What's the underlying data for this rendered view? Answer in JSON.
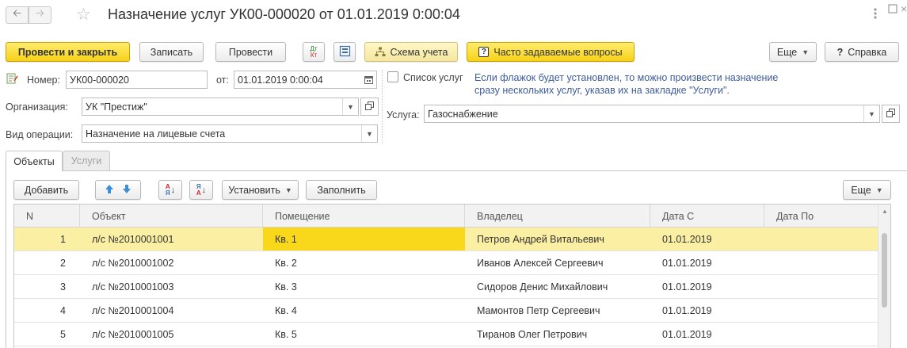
{
  "title": "Назначение услуг УК00-000020 от 01.01.2019 0:00:04",
  "toolbar": {
    "post_close": "Провести и закрыть",
    "save": "Записать",
    "post": "Провести",
    "dtkt_icon_text": "Дт Кт",
    "scheme": "Схема учета",
    "faq": "Часто задаваемые вопросы",
    "more": "Еще",
    "help": "Справка"
  },
  "form": {
    "number_label": "Номер:",
    "number_value": "УК00-000020",
    "from_label": "от:",
    "date_value": "01.01.2019  0:00:04",
    "org_label": "Организация:",
    "org_value": "УК \"Престиж\"",
    "op_label": "Вид операции:",
    "op_value": "Назначение на лицевые счета",
    "services_list_label": "Список услуг",
    "hint_line1": "Если флажок будет установлен, то можно произвести назначение",
    "hint_line2": "сразу нескольких услуг, указав их на закладке \"Услуги\".",
    "service_label": "Услуга:",
    "service_value": "Газоснабжение"
  },
  "tabs": [
    "Объекты",
    "Услуги"
  ],
  "table_toolbar": {
    "add": "Добавить",
    "set": "Установить",
    "fill": "Заполнить",
    "more": "Еще"
  },
  "table": {
    "columns": [
      "N",
      "Объект",
      "Помещение",
      "Владелец",
      "Дата С",
      "Дата По"
    ],
    "rows": [
      {
        "n": "1",
        "object": "л/с №2010001001",
        "room": "Кв. 1",
        "owner": "Петров Андрей Витальевич",
        "date_from": "01.01.2019",
        "date_to": ""
      },
      {
        "n": "2",
        "object": "л/с №2010001002",
        "room": "Кв. 2",
        "owner": "Иванов Алексей Сергеевич",
        "date_from": "01.01.2019",
        "date_to": ""
      },
      {
        "n": "3",
        "object": "л/с №2010001003",
        "room": "Кв. 3",
        "owner": "Сидоров Денис Михайлович",
        "date_from": "01.01.2019",
        "date_to": ""
      },
      {
        "n": "4",
        "object": "л/с №2010001004",
        "room": "Кв. 4",
        "owner": "Мамонтов Петр Сергеевич",
        "date_from": "01.01.2019",
        "date_to": ""
      },
      {
        "n": "5",
        "object": "л/с №2010001005",
        "room": "Кв. 5",
        "owner": "Тиранов Олег Петрович",
        "date_from": "01.01.2019",
        "date_to": ""
      }
    ]
  },
  "colors": {
    "accent_yellow": "#f7d21a",
    "selected_row": "#fbefa3",
    "hint_blue": "#3e5c9a",
    "arrow_blue": "#3b8fd9"
  }
}
